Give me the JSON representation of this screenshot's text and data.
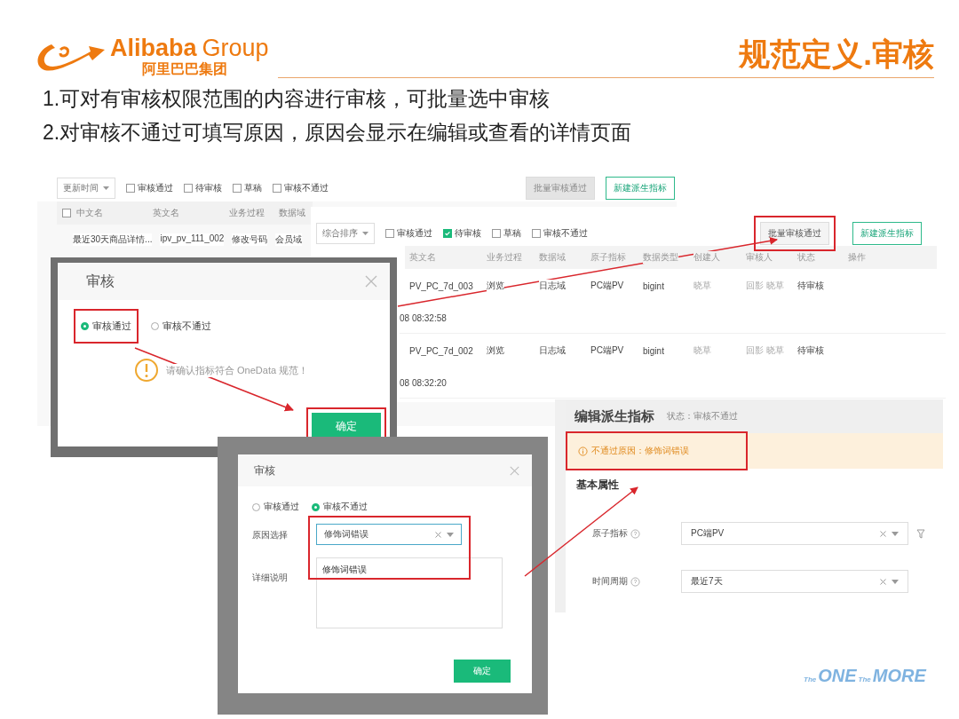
{
  "header": {
    "logo_name": "Alibaba",
    "logo_group": "Group",
    "logo_cn": "阿里巴巴集团",
    "title": "规范定义.审核"
  },
  "points": [
    "1.可对有审核权限范围的内容进行审核，可批量选中审核",
    "2.对审核不通过可填写原因，原因会显示在编辑或查看的详情页面"
  ],
  "list_back": {
    "sort": "更新时间",
    "filters": [
      {
        "label": "审核通过",
        "checked": false
      },
      {
        "label": "待审核",
        "checked": false
      },
      {
        "label": "草稿",
        "checked": false
      },
      {
        "label": "审核不通过",
        "checked": false
      }
    ],
    "buttons": [
      {
        "label": "批量审核通过",
        "kind": "plain",
        "disabled": true
      },
      {
        "label": "新建派生指标",
        "kind": "outline",
        "disabled": false
      }
    ],
    "select_all_checked": false,
    "columns": [
      "中文名",
      "英文名",
      "业务过程",
      "数据域"
    ],
    "rows": [
      [
        "最近30天商品详情...",
        "ipv_pv_111_002",
        "修改号码",
        "会员域"
      ]
    ]
  },
  "list_front": {
    "sort": "综合排序",
    "filters": [
      {
        "label": "审核通过",
        "checked": false
      },
      {
        "label": "待审核",
        "checked": true
      },
      {
        "label": "草稿",
        "checked": false
      },
      {
        "label": "审核不通过",
        "checked": false
      }
    ],
    "buttons": [
      {
        "label": "批量审核通过",
        "kind": "plain",
        "disabled": false,
        "highlighted": true
      },
      {
        "label": "新建派生指标",
        "kind": "outline",
        "disabled": false,
        "highlighted": false
      }
    ],
    "columns": [
      "英文名",
      "业务过程",
      "数据域",
      "原子指标",
      "数据类型",
      "创建人",
      "审核人",
      "状态",
      "操作"
    ],
    "rows": [
      {
        "cells": [
          "PV_PC_7d_003",
          "浏览",
          "日志域",
          "PC端PV",
          "bigint",
          "晓草",
          "回影 晓草",
          "待审核",
          ""
        ],
        "time": "08 08:32:58"
      },
      {
        "cells": [
          "PV_PC_7d_002",
          "浏览",
          "日志域",
          "PC端PV",
          "bigint",
          "晓草",
          "回影 晓草",
          "待审核",
          ""
        ],
        "time": "08 08:32:20"
      }
    ]
  },
  "dialog_pass": {
    "title": "审核",
    "options": [
      {
        "label": "审核通过",
        "selected": true,
        "highlighted": true
      },
      {
        "label": "审核不通过",
        "selected": false,
        "highlighted": false
      }
    ],
    "notice": "请确认指标符合 OneData 规范！",
    "confirm": "确定",
    "confirm_highlighted": true
  },
  "dialog_reject": {
    "title": "审核",
    "options": [
      {
        "label": "审核通过",
        "selected": false
      },
      {
        "label": "审核不通过",
        "selected": true
      }
    ],
    "reason_label": "原因选择",
    "reason_value": "修饰词错误",
    "detail_label": "详细说明",
    "detail_value": "修饰词错误",
    "fields_highlighted": true,
    "confirm": "确定"
  },
  "edit_page": {
    "title": "编辑派生指标",
    "status": "状态：审核不通过",
    "alert": "不通过原因：修饰词错误",
    "alert_highlighted": true,
    "section": "基本属性",
    "fields": [
      {
        "label": "原子指标",
        "value": "PC端PV",
        "filter": true
      },
      {
        "label": "时间周期",
        "value": "最近7天",
        "filter": false
      }
    ]
  },
  "footer_logo": {
    "left": "The",
    "one": "ONE",
    "mid": "The",
    "more": "MORE"
  }
}
